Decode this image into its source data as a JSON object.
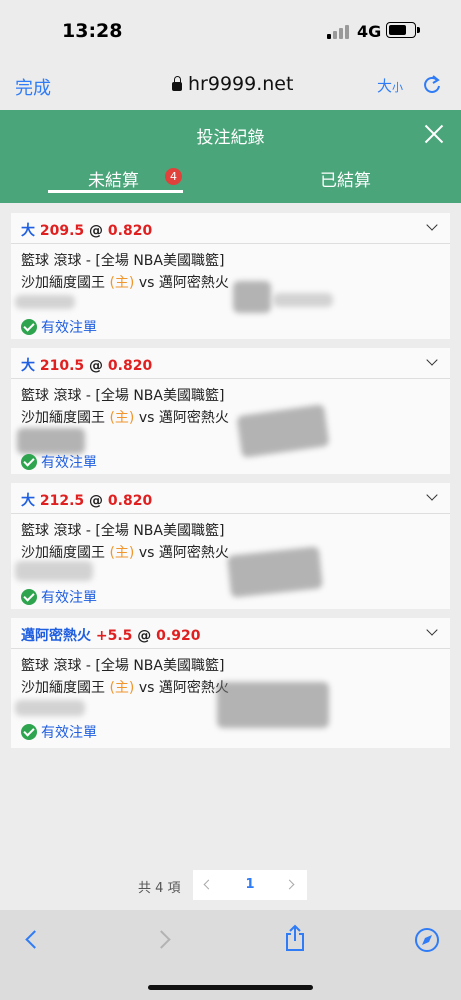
{
  "status": {
    "time": "13:28",
    "network": "4G"
  },
  "browser": {
    "done": "完成",
    "url": "hr9999.net",
    "text_size_big": "大",
    "text_size_small": "小"
  },
  "header": {
    "title": "投注紀錄",
    "tabs": [
      {
        "label": "未結算",
        "badge": "4",
        "active": true
      },
      {
        "label": "已結算",
        "active": false
      }
    ]
  },
  "bets": [
    {
      "pick": "大",
      "line": "209.5",
      "at": "@",
      "odds": "0.820",
      "league": "籃球 滾球 - [全場 NBA美國職籃]",
      "home": "沙加緬度國王",
      "home_tag": "(主)",
      "vs": "vs",
      "away": "邁阿密熱火",
      "status": "有效注單"
    },
    {
      "pick": "大",
      "line": "210.5",
      "at": "@",
      "odds": "0.820",
      "league": "籃球 滾球 - [全場 NBA美國職籃]",
      "home": "沙加緬度國王",
      "home_tag": "(主)",
      "vs": "vs",
      "away": "邁阿密熱火",
      "status": "有效注單"
    },
    {
      "pick": "大",
      "line": "212.5",
      "at": "@",
      "odds": "0.820",
      "league": "籃球 滾球 - [全場 NBA美國職籃]",
      "home": "沙加緬度國王",
      "home_tag": "(主)",
      "vs": "vs",
      "away": "邁阿密熱火",
      "status": "有效注單"
    },
    {
      "pick": "邁阿密熱火",
      "line": "+5.5",
      "at": "@",
      "odds": "0.920",
      "league": "籃球 滾球 - [全場 NBA美國職籃]",
      "home": "沙加緬度國王",
      "home_tag": "(主)",
      "vs": "vs",
      "away": "邁阿密熱火",
      "status": "有效注單"
    }
  ],
  "pagination": {
    "total": "共 4 項",
    "current": "1"
  },
  "colors": {
    "header_green": "#4aa57a",
    "link_blue": "#2f7cf6",
    "odds_red": "#e02020",
    "home_orange": "#f0962c",
    "valid_green": "#2ea44f"
  }
}
